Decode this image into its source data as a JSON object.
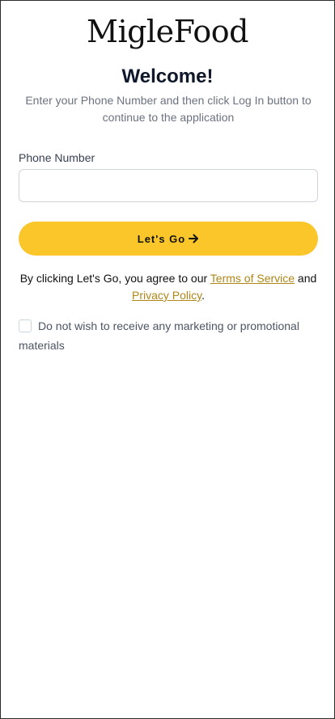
{
  "app": {
    "logo_text": "MigleFood"
  },
  "welcome": {
    "title": "Welcome!",
    "subtitle": "Enter your Phone Number and then click Log In button to continue to the application"
  },
  "form": {
    "phone_label": "Phone Number",
    "phone_value": "",
    "submit_label": "Let's Go",
    "submit_icon": "arrow-right-icon"
  },
  "legal": {
    "prefix": "By clicking Let's Go, you agree to our ",
    "terms_label": "Terms of Service",
    "middle": " and ",
    "privacy_label": "Privacy Policy",
    "suffix": "."
  },
  "marketing_optout": {
    "label": "Do not wish to receive any marketing or promotional materials",
    "checked": false
  },
  "colors": {
    "accent": "#fbc62a",
    "link": "#b08618"
  }
}
